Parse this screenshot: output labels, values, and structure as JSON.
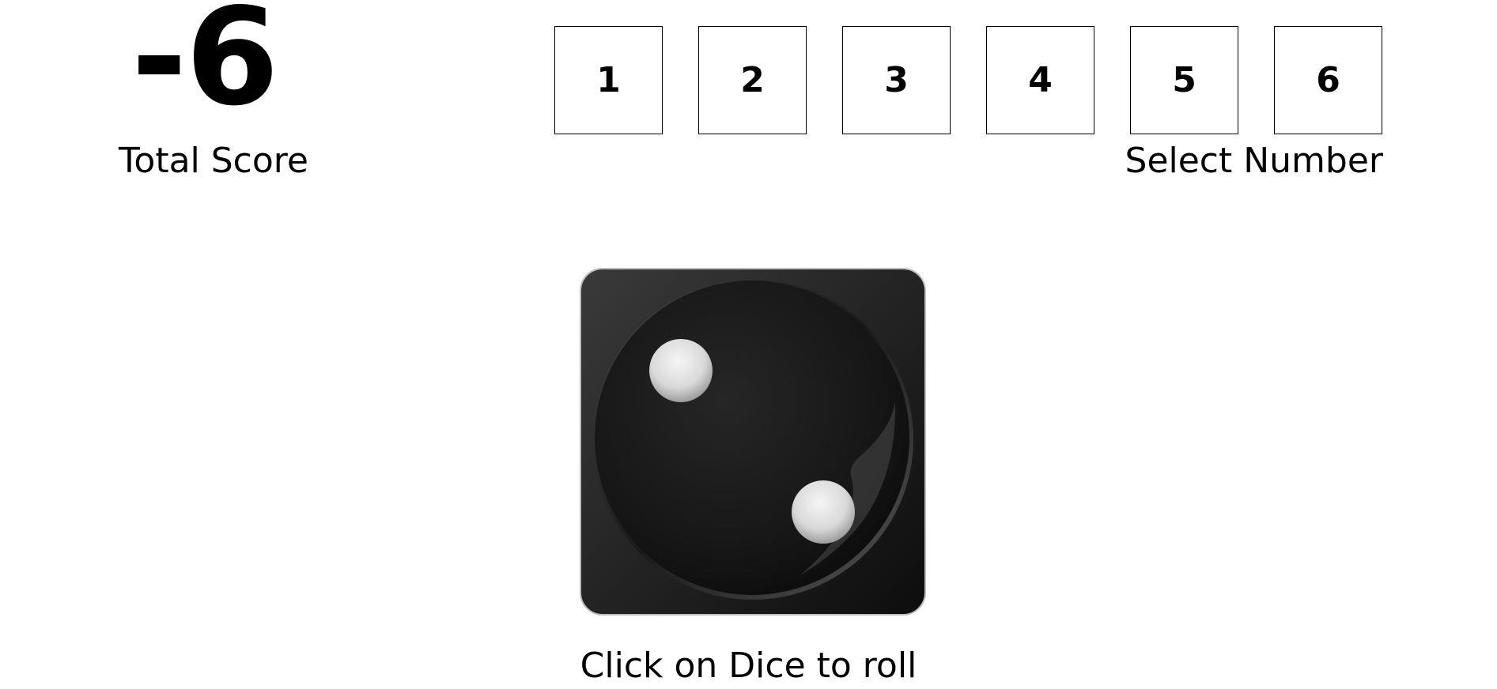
{
  "score": {
    "value": "-6",
    "label": "Total Score"
  },
  "number_select": {
    "options": [
      "1",
      "2",
      "3",
      "4",
      "5",
      "6"
    ],
    "label": "Select Number"
  },
  "dice": {
    "face_value": 2,
    "icon": "dice-face-two-icon",
    "face_color": "#1c1c1c",
    "pip_color": "#e6e6e6"
  },
  "instruction": {
    "text": "Click on Dice to roll"
  }
}
